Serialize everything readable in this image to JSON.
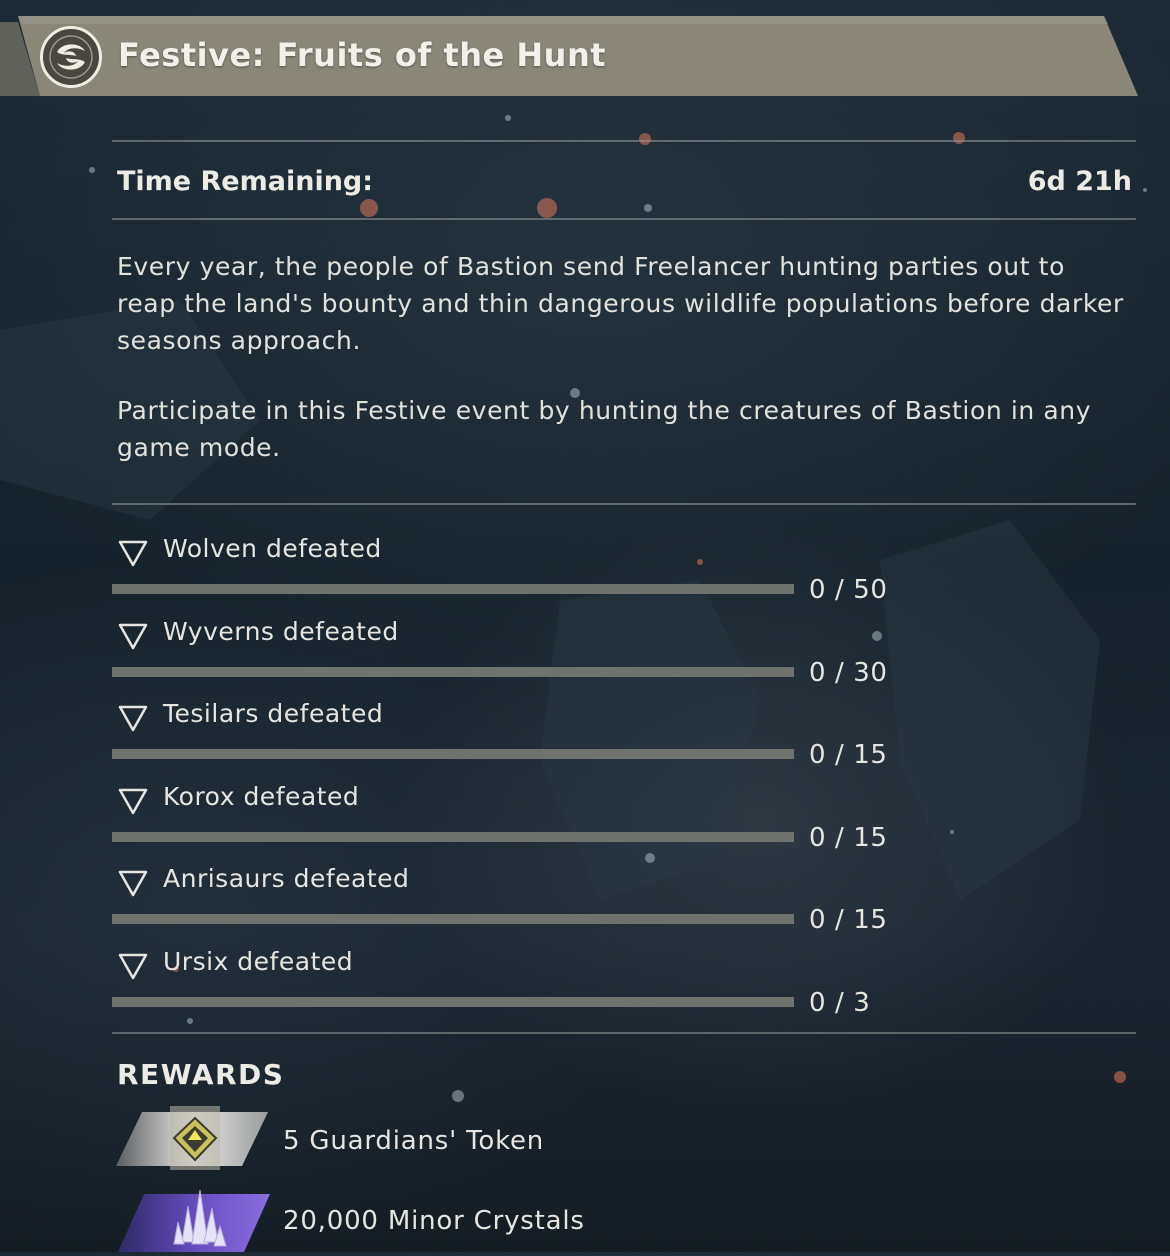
{
  "header": {
    "title": "Festive: Fruits of the Hunt",
    "icon": "swirl-emblem-icon"
  },
  "time": {
    "label": "Time Remaining:",
    "value": "6d 21h"
  },
  "description": [
    "Every year, the people of Bastion send Freelancer hunting parties out to reap the land's bounty and thin dangerous wildlife populations before darker seasons approach.",
    "Participate in this Festive event by hunting the creatures of Bastion in any game mode."
  ],
  "objectives": [
    {
      "label": "Wolven defeated",
      "current": 0,
      "target": 50,
      "count": "0 / 50"
    },
    {
      "label": "Wyverns defeated",
      "current": 0,
      "target": 30,
      "count": "0 / 30"
    },
    {
      "label": "Tesilars defeated",
      "current": 0,
      "target": 15,
      "count": "0 / 15"
    },
    {
      "label": "Korox defeated",
      "current": 0,
      "target": 15,
      "count": "0 / 15"
    },
    {
      "label": "Anrisaurs defeated",
      "current": 0,
      "target": 15,
      "count": "0 / 15"
    },
    {
      "label": "Ursix defeated",
      "current": 0,
      "target": 3,
      "count": "0 / 3"
    }
  ],
  "rewards": {
    "heading": "REWARDS",
    "items": [
      {
        "label": "5 Guardians' Token",
        "icon": "guardians-token-icon"
      },
      {
        "label": "20,000 Minor Crystals",
        "icon": "minor-crystals-icon"
      }
    ]
  },
  "colors": {
    "banner": "#8a8779",
    "bar_track": "#6f726d",
    "bar_fill": "#e8e4cf",
    "crystal_purple": "#6a4fc4"
  }
}
